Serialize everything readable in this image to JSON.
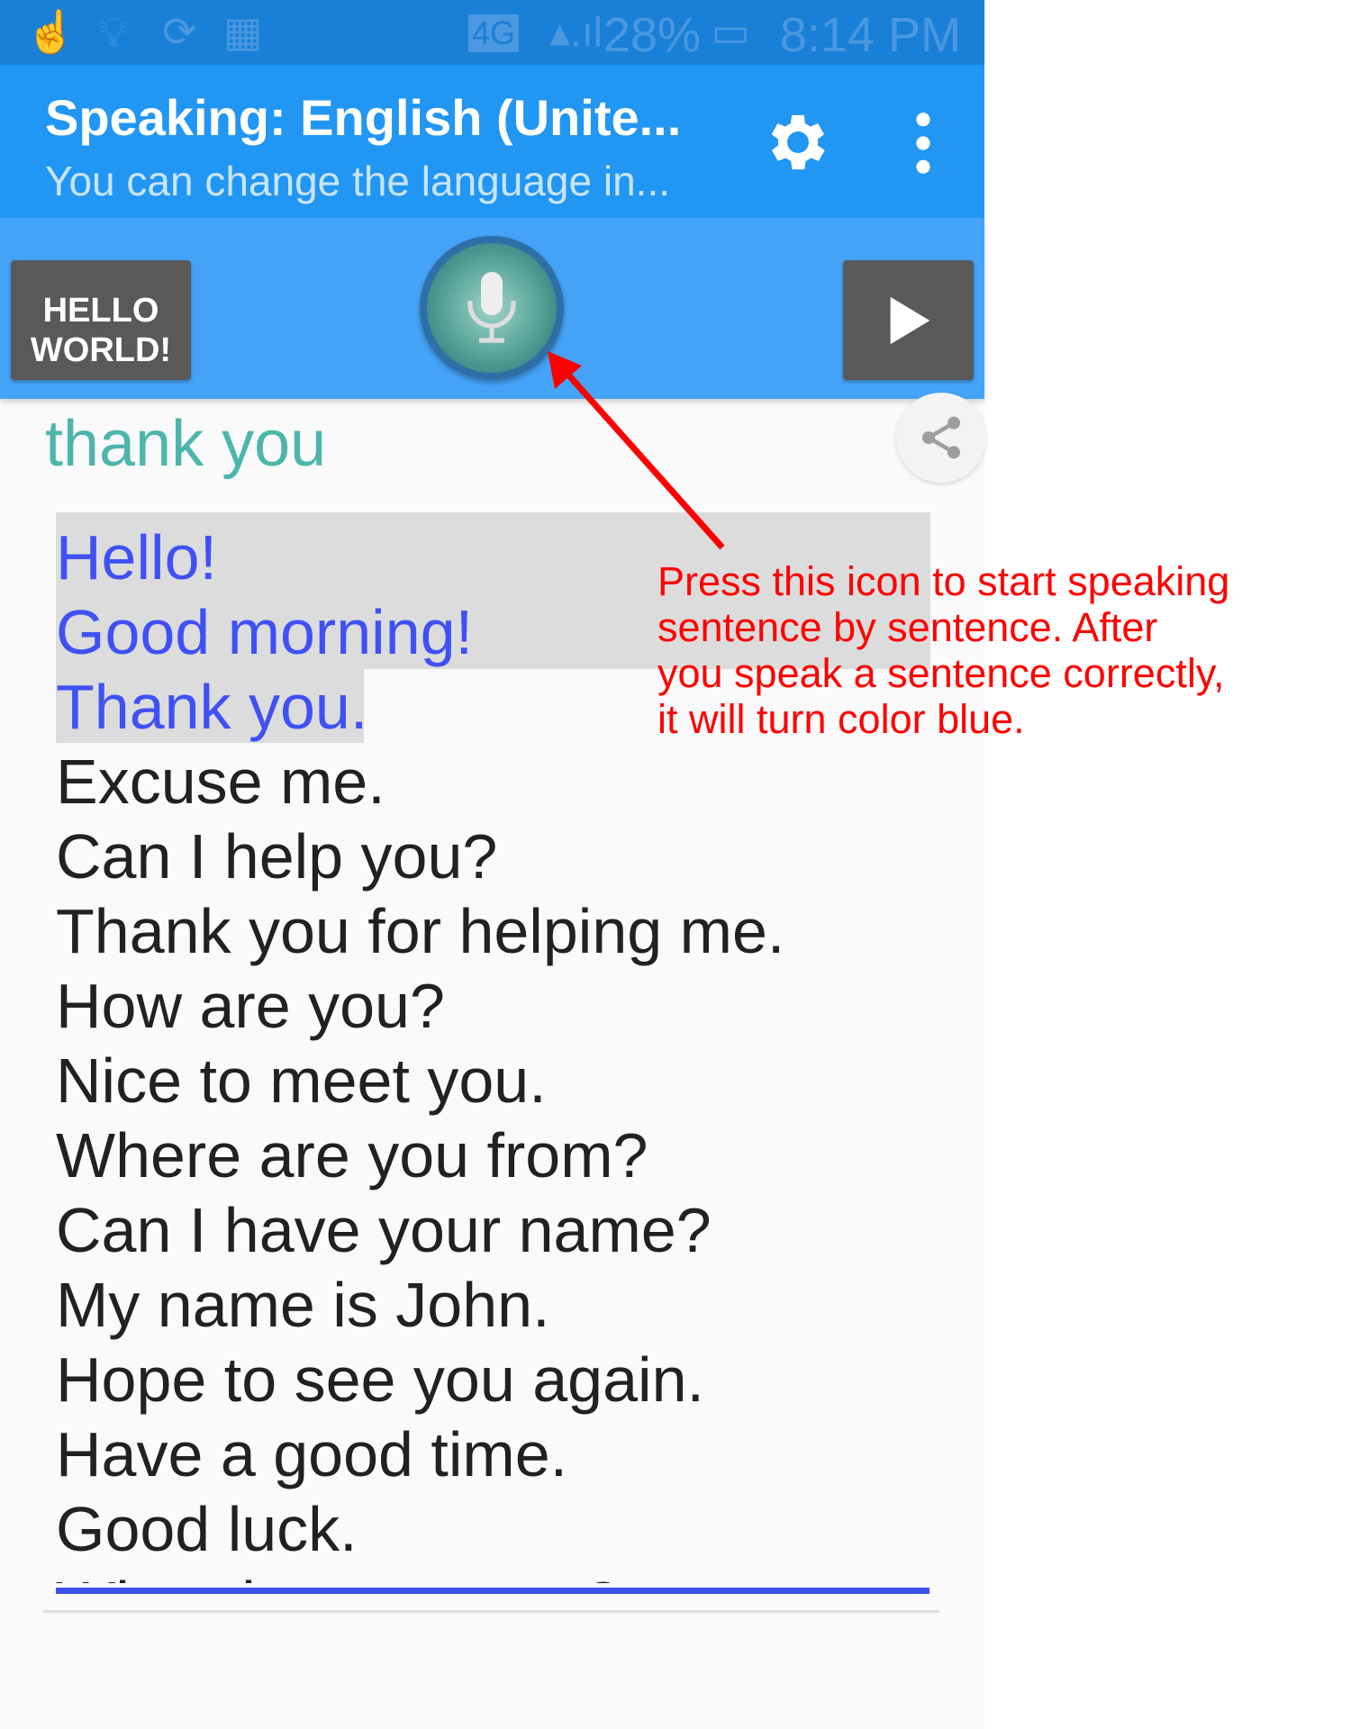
{
  "status_bar": {
    "network": "4G",
    "battery": "28%",
    "time": "8:14 PM",
    "icons": [
      "touch-icon",
      "lightbulb-icon",
      "download-icon",
      "brightness-icon",
      "signal-icon",
      "battery-icon"
    ]
  },
  "app_bar": {
    "title": "Speaking: English (Unite...",
    "subtitle": "You can change the language in...",
    "icons": [
      "gear-icon",
      "more-vert-icon"
    ]
  },
  "toolbar": {
    "hello_button": "HELLO WORLD!",
    "mic_icon": "microphone-icon",
    "play_icon": "play-icon"
  },
  "share_icon": "share-icon",
  "recognized_text": "thank you",
  "sentences": [
    {
      "text": "Hello!",
      "done": true
    },
    {
      "text": "Good morning!",
      "done": true
    },
    {
      "text": "Thank you.",
      "done": true
    },
    {
      "text": "Excuse me.",
      "done": false
    },
    {
      "text": "Can I help you?",
      "done": false
    },
    {
      "text": "Thank you for helping me.",
      "done": false
    },
    {
      "text": "How are you?",
      "done": false
    },
    {
      "text": "Nice to meet you.",
      "done": false
    },
    {
      "text": "Where are you from?",
      "done": false
    },
    {
      "text": "Can I have your name?",
      "done": false
    },
    {
      "text": "My name is John.",
      "done": false
    },
    {
      "text": "Hope to see you again.",
      "done": false
    },
    {
      "text": "Have a good time.",
      "done": false
    },
    {
      "text": "Good luck.",
      "done": false
    },
    {
      "text": "What do you mean?",
      "done": false
    }
  ],
  "annotation": {
    "lines": [
      "Press this icon to start speaking",
      "sentence by sentence. After",
      "you speak a sentence correctly,",
      "it will turn color blue."
    ],
    "color": "#ff0000"
  },
  "colors": {
    "status": "#1a7fd6",
    "appbar": "#2196f3",
    "toolbar": "#45a4f7",
    "done": "#3f51f5",
    "recognized": "#4db6ac"
  }
}
